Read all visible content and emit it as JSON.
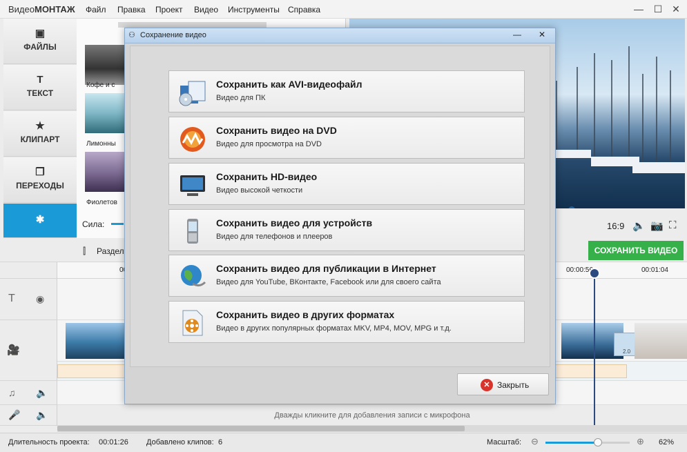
{
  "app": {
    "name_light": "Видео",
    "name_bold": "МОНТАЖ"
  },
  "menu": [
    "Файл",
    "Правка",
    "Проект",
    "Видео",
    "Инструменты",
    "Справка"
  ],
  "window_controls": {
    "minimize": "—",
    "maximize": "☐",
    "close": "✕"
  },
  "sidebar": [
    {
      "label": "ФАЙЛЫ",
      "icon": "image-icon",
      "glyph": "▣"
    },
    {
      "label": "ТЕКСТ",
      "icon": "text-icon",
      "glyph": "T"
    },
    {
      "label": "КЛИПАРТ",
      "icon": "star-icon",
      "glyph": "★"
    },
    {
      "label": "ПЕРЕХОДЫ",
      "icon": "transitions-icon",
      "glyph": "❐"
    },
    {
      "label": "",
      "icon": "effects-icon",
      "glyph": "✱"
    }
  ],
  "effects": [
    {
      "label": "Кофе и с"
    },
    {
      "label": "Лимонны"
    },
    {
      "label": "Фиолетов"
    }
  ],
  "strength_label": "Сила:",
  "preview": {
    "aspect": "16:9"
  },
  "save_button": "СОХРАНИТЬ ВИДЕО",
  "toolbar": {
    "split_label": "Раздел"
  },
  "ruler": {
    "t1": "00",
    "t2": "00:00:56",
    "t3": "00:01:04"
  },
  "timeline": {
    "mic_hint": "Дважды кликните для добавления записи с микрофона",
    "clip_badge": "2.0"
  },
  "status": {
    "duration_label": "Длительность проекта:",
    "duration_value": "00:01:26",
    "clips_label": "Добавлено клипов:",
    "clips_value": "6",
    "scale_label": "Масштаб:",
    "zoom_value": "62%",
    "zoom_fraction": 0.62
  },
  "dialog": {
    "title": "Сохранение видео",
    "options": [
      {
        "title": "Сохранить как AVI-видеофайл",
        "subtitle": "Видео для ПК",
        "icon": "avi-file-icon"
      },
      {
        "title": "Сохранить видео на DVD",
        "subtitle": "Видео для просмотра на DVD",
        "icon": "dvd-icon"
      },
      {
        "title": "Сохранить HD-видео",
        "subtitle": "Видео высокой четкости",
        "icon": "hd-monitor-icon"
      },
      {
        "title": "Сохранить видео для устройств",
        "subtitle": "Видео для телефонов и плееров",
        "icon": "phone-icon"
      },
      {
        "title": "Сохранить видео для публикации в Интернет",
        "subtitle": "Видео для YouTube, ВКонтакте, Facebook или для своего сайта",
        "icon": "globe-icon"
      },
      {
        "title": "Сохранить видео в других форматах",
        "subtitle": "Видео в других популярных форматах MKV, MP4, MOV, MPG и т.д.",
        "icon": "film-reel-icon"
      }
    ],
    "close_label": "Закрыть"
  }
}
